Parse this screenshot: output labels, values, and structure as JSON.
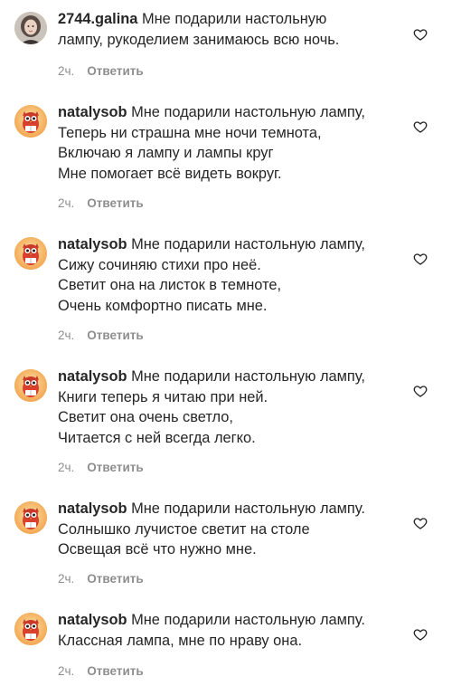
{
  "reply_label": "Ответить",
  "comments": [
    {
      "username": "2744.galina",
      "text": "Мне подарили настольную\nлампу, рукоделием занимаюсь всю ночь.",
      "time": "2ч.",
      "avatar": "portrait-avatar"
    },
    {
      "username": "natalysob",
      "text": "Мне подарили настольную лампу,\nТеперь ни страшна мне ночи темнота,\nВключаю я лампу и лампы круг\nМне помогает всё видеть вокруг.",
      "time": "2ч.",
      "avatar": "owl-avatar"
    },
    {
      "username": "natalysob",
      "text": "Мне подарили настольную лампу,\nСижу сочиняю стихи про неё.\nСветит она на листок в темноте,\nОчень комфортно писать мне.",
      "time": "2ч.",
      "avatar": "owl-avatar"
    },
    {
      "username": "natalysob",
      "text": "Мне подарили настольную лампу,\nКниги теперь я читаю при ней.\nСветит она очень светло,\nЧитается с ней всегда легко.",
      "time": "2ч.",
      "avatar": "owl-avatar"
    },
    {
      "username": "natalysob",
      "text": "Мне подарили настольную лампу.\nСолнышко лучистое светит на столе\nОсвещая всё что нужно мне.",
      "time": "2ч.",
      "avatar": "owl-avatar"
    },
    {
      "username": "natalysob",
      "text": "Мне подарили настольную лампу.\nКлассная лампа, мне по нраву она.",
      "time": "2ч.",
      "avatar": "owl-avatar"
    }
  ]
}
